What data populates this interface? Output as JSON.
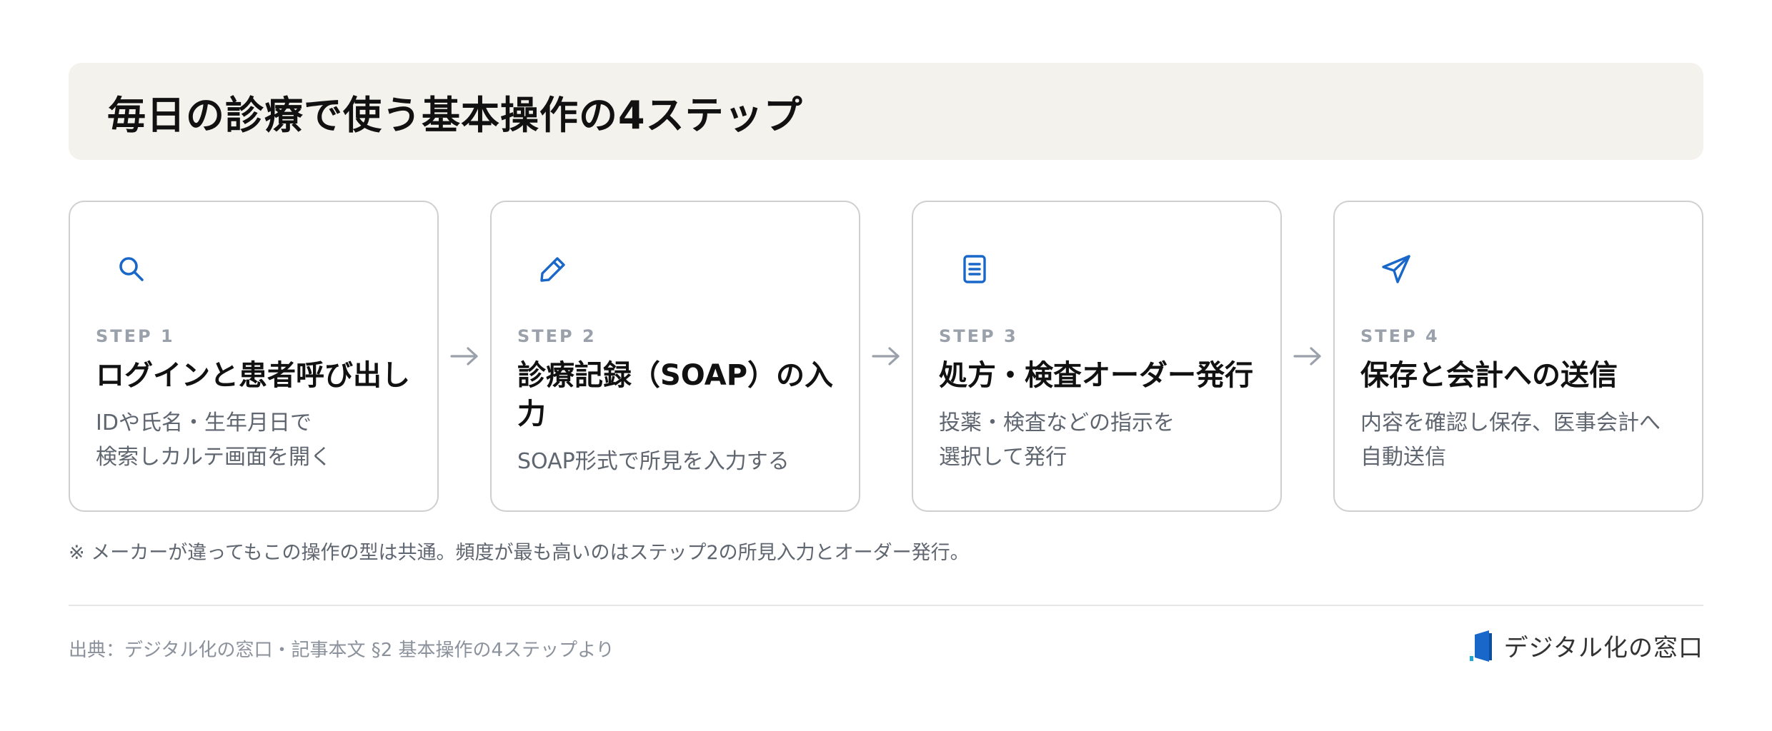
{
  "title": "毎日の診療で使う基本操作の4ステップ",
  "accent_color": "#1967c9",
  "steps": [
    {
      "icon": "search-icon",
      "label": "STEP 1",
      "title": "ログインと患者呼び出し",
      "description": "IDや氏名・生年月日で\n検索しカルテ画面を開く"
    },
    {
      "icon": "pencil-icon",
      "label": "STEP 2",
      "title": "診療記録（SOAP）の入力",
      "description": "SOAP形式で所見を入力する"
    },
    {
      "icon": "document-icon",
      "label": "STEP 3",
      "title": "処方・検査オーダー発行",
      "description": "投薬・検査などの指示を\n選択して発行"
    },
    {
      "icon": "send-icon",
      "label": "STEP 4",
      "title": "保存と会計への送信",
      "description": "内容を確認し保存、医事会計へ\n自動送信"
    }
  ],
  "note": "※ メーカーが違ってもこの操作の型は共通。頻度が最も高いのはステップ2の所見入力とオーダー発行。",
  "source": "出典：デジタル化の窓口・記事本文 §2 基本操作の4ステップより",
  "brand": {
    "name": "デジタル化の窓口",
    "icon": "logo-icon"
  }
}
